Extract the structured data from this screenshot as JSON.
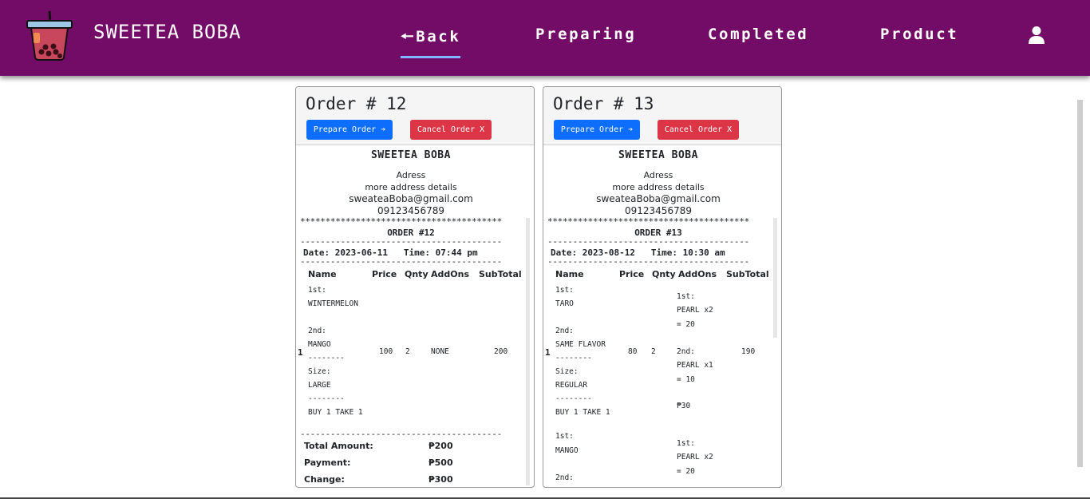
{
  "brand": {
    "name": "SWEETEA BOBA",
    "logo_icon": "boba-cup-icon"
  },
  "nav": {
    "back": "🠔Back",
    "preparing": "Preparing",
    "completed": "Completed",
    "product": "Product",
    "user_icon": "user-icon"
  },
  "colors": {
    "navbar": "#730c67",
    "primary": "#0d6efd",
    "danger": "#dc3545",
    "active_underline": "#7fb6ff"
  },
  "orders": [
    {
      "title": "Order # 12",
      "prepare_label": "Prepare Order ➔",
      "cancel_label": "Cancel Order X",
      "receipt": {
        "store": "SWEETEA BOBA",
        "address": "Adress",
        "address_details": "more address details",
        "email": "sweateaBoba@gmail.com",
        "phone": "09123456789",
        "stars": "****************************************",
        "order_no": "ORDER #12",
        "dashes": "----------------------------------------",
        "date_label": "Date:",
        "date": "2023-06-11",
        "time_label": "Time:",
        "time": "07:44 pm",
        "headers": [
          "Name",
          "Price",
          "Qnty",
          "AddOns",
          "SubTotal"
        ],
        "items": [
          {
            "index": "1",
            "name_lines": [
              "1st:",
              "WINTERMELON",
              "",
              "2nd:",
              "MANGO",
              "--------",
              "Size:",
              "LARGE",
              "--------",
              "BUY 1 TAKE 1"
            ],
            "price": "100",
            "qty": "2",
            "addons_lines": [
              "NONE"
            ],
            "subtotal": "200"
          }
        ],
        "total_label": "Total Amount:",
        "total": "₱200",
        "payment_label": "Payment:",
        "payment": "₱500",
        "change_label": "Change:",
        "change": "₱300"
      }
    },
    {
      "title": "Order # 13",
      "prepare_label": "Prepare Order ➔",
      "cancel_label": "Cancel Order X",
      "receipt": {
        "store": "SWEETEA BOBA",
        "address": "Adress",
        "address_details": "more address details",
        "email": "sweateaBoba@gmail.com",
        "phone": "09123456789",
        "stars": "****************************************",
        "order_no": "ORDER #13",
        "dashes": "----------------------------------------",
        "date_label": "Date:",
        "date": "2023-08-12",
        "time_label": "Time:",
        "time": "10:30 am",
        "headers": [
          "Name",
          "Price",
          "Qnty",
          "AddOns",
          "SubTotal"
        ],
        "items": [
          {
            "index": "1",
            "name_lines": [
              "1st:",
              "TARO",
              "",
              "2nd:",
              "SAME FLAVOR",
              "--------",
              "Size:",
              "REGULAR",
              "--------",
              "BUY 1 TAKE 1",
              "",
              "",
              "1st:",
              "MANGO",
              "",
              "2nd:"
            ],
            "price": "80",
            "qty": "2",
            "addons_lines": [
              "1st:",
              "PEARL x2",
              "= 20",
              "",
              "2nd:",
              "PEARL x1",
              "= 10",
              "",
              "₱30",
              "",
              "",
              "1st:",
              "PEARL x2",
              "= 20"
            ],
            "subtotal": "190"
          }
        ]
      }
    }
  ]
}
